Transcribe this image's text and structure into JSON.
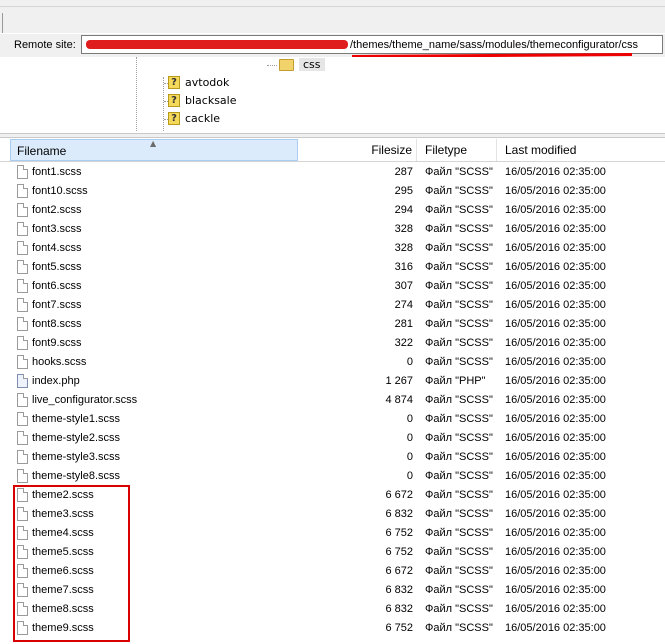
{
  "remote": {
    "label": "Remote site:",
    "path_visible": "/themes/theme_name/sass/modules/themeconfigurator/css"
  },
  "tree": {
    "folder": "css",
    "items": [
      "avtodok",
      "blacksale",
      "cackle"
    ]
  },
  "columns": {
    "filename": "Filename",
    "filesize": "Filesize",
    "filetype": "Filetype",
    "modified": "Last modified"
  },
  "files": [
    {
      "name": "font1.scss",
      "size": "287",
      "type": "Файл \"SCSS\"",
      "modified": "16/05/2016 02:35:00",
      "icon": "file-icon"
    },
    {
      "name": "font10.scss",
      "size": "295",
      "type": "Файл \"SCSS\"",
      "modified": "16/05/2016 02:35:00",
      "icon": "file-icon"
    },
    {
      "name": "font2.scss",
      "size": "294",
      "type": "Файл \"SCSS\"",
      "modified": "16/05/2016 02:35:00",
      "icon": "file-icon"
    },
    {
      "name": "font3.scss",
      "size": "328",
      "type": "Файл \"SCSS\"",
      "modified": "16/05/2016 02:35:00",
      "icon": "file-icon"
    },
    {
      "name": "font4.scss",
      "size": "328",
      "type": "Файл \"SCSS\"",
      "modified": "16/05/2016 02:35:00",
      "icon": "file-icon"
    },
    {
      "name": "font5.scss",
      "size": "316",
      "type": "Файл \"SCSS\"",
      "modified": "16/05/2016 02:35:00",
      "icon": "file-icon"
    },
    {
      "name": "font6.scss",
      "size": "307",
      "type": "Файл \"SCSS\"",
      "modified": "16/05/2016 02:35:00",
      "icon": "file-icon"
    },
    {
      "name": "font7.scss",
      "size": "274",
      "type": "Файл \"SCSS\"",
      "modified": "16/05/2016 02:35:00",
      "icon": "file-icon"
    },
    {
      "name": "font8.scss",
      "size": "281",
      "type": "Файл \"SCSS\"",
      "modified": "16/05/2016 02:35:00",
      "icon": "file-icon"
    },
    {
      "name": "font9.scss",
      "size": "322",
      "type": "Файл \"SCSS\"",
      "modified": "16/05/2016 02:35:00",
      "icon": "file-icon"
    },
    {
      "name": "hooks.scss",
      "size": "0",
      "type": "Файл \"SCSS\"",
      "modified": "16/05/2016 02:35:00",
      "icon": "file-icon"
    },
    {
      "name": "index.php",
      "size": "1 267",
      "type": "Файл \"PHP\"",
      "modified": "16/05/2016 02:35:00",
      "icon": "php-file-icon"
    },
    {
      "name": "live_configurator.scss",
      "size": "4 874",
      "type": "Файл \"SCSS\"",
      "modified": "16/05/2016 02:35:00",
      "icon": "file-icon"
    },
    {
      "name": "theme-style1.scss",
      "size": "0",
      "type": "Файл \"SCSS\"",
      "modified": "16/05/2016 02:35:00",
      "icon": "file-icon"
    },
    {
      "name": "theme-style2.scss",
      "size": "0",
      "type": "Файл \"SCSS\"",
      "modified": "16/05/2016 02:35:00",
      "icon": "file-icon"
    },
    {
      "name": "theme-style3.scss",
      "size": "0",
      "type": "Файл \"SCSS\"",
      "modified": "16/05/2016 02:35:00",
      "icon": "file-icon"
    },
    {
      "name": "theme-style8.scss",
      "size": "0",
      "type": "Файл \"SCSS\"",
      "modified": "16/05/2016 02:35:00",
      "icon": "file-icon"
    },
    {
      "name": "theme2.scss",
      "size": "6 672",
      "type": "Файл \"SCSS\"",
      "modified": "16/05/2016 02:35:00",
      "icon": "file-icon"
    },
    {
      "name": "theme3.scss",
      "size": "6 832",
      "type": "Файл \"SCSS\"",
      "modified": "16/05/2016 02:35:00",
      "icon": "file-icon"
    },
    {
      "name": "theme4.scss",
      "size": "6 752",
      "type": "Файл \"SCSS\"",
      "modified": "16/05/2016 02:35:00",
      "icon": "file-icon"
    },
    {
      "name": "theme5.scss",
      "size": "6 752",
      "type": "Файл \"SCSS\"",
      "modified": "16/05/2016 02:35:00",
      "icon": "file-icon"
    },
    {
      "name": "theme6.scss",
      "size": "6 672",
      "type": "Файл \"SCSS\"",
      "modified": "16/05/2016 02:35:00",
      "icon": "file-icon"
    },
    {
      "name": "theme7.scss",
      "size": "6 832",
      "type": "Файл \"SCSS\"",
      "modified": "16/05/2016 02:35:00",
      "icon": "file-icon"
    },
    {
      "name": "theme8.scss",
      "size": "6 832",
      "type": "Файл \"SCSS\"",
      "modified": "16/05/2016 02:35:00",
      "icon": "file-icon"
    },
    {
      "name": "theme9.scss",
      "size": "6 752",
      "type": "Файл \"SCSS\"",
      "modified": "16/05/2016 02:35:00",
      "icon": "file-icon"
    }
  ],
  "colors": {
    "annotation_red": "#d90000",
    "header_selected": "#dcebfb"
  }
}
